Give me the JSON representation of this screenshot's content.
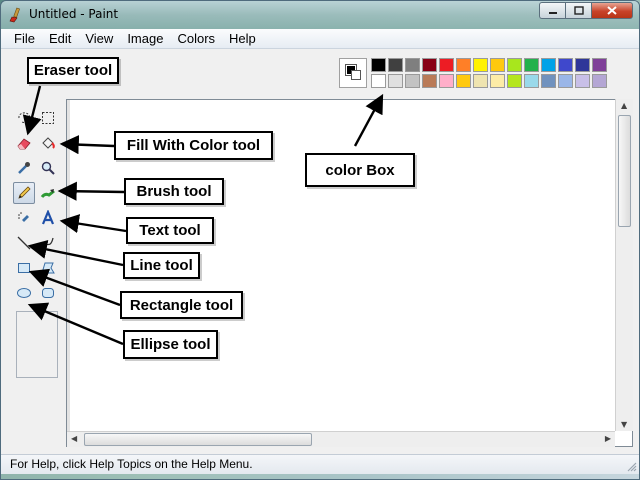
{
  "window": {
    "title": "Untitled - Paint",
    "app_icon": "paint-brush-icon",
    "controls": [
      "minimize-icon",
      "maximize-icon",
      "close-icon"
    ]
  },
  "menubar": {
    "items": [
      "File",
      "Edit",
      "View",
      "Image",
      "Colors",
      "Help"
    ]
  },
  "toolbox": {
    "tools": [
      {
        "icon": "free-form-select-icon"
      },
      {
        "icon": "rectangle-select-icon"
      },
      {
        "icon": "eraser-icon"
      },
      {
        "icon": "fill-bucket-icon"
      },
      {
        "icon": "color-picker-icon"
      },
      {
        "icon": "magnifier-icon"
      },
      {
        "icon": "pencil-icon",
        "selected": true
      },
      {
        "icon": "brush-icon"
      },
      {
        "icon": "airbrush-icon"
      },
      {
        "icon": "text-icon"
      },
      {
        "icon": "line-icon"
      },
      {
        "icon": "curve-icon"
      },
      {
        "icon": "rectangle-icon"
      },
      {
        "icon": "polygon-icon"
      },
      {
        "icon": "ellipse-icon"
      },
      {
        "icon": "rounded-rectangle-icon"
      }
    ]
  },
  "palette": {
    "foreground": "#000000",
    "background": "#ffffff",
    "row1": [
      "#000000",
      "#404040",
      "#7f7f7f",
      "#880015",
      "#ed1c24",
      "#ff7f27",
      "#fff200",
      "#ffc90e",
      "#a8e61d",
      "#22b14c",
      "#00a2e8",
      "#3f48cc",
      "#2f3699",
      "#7f3f98"
    ],
    "row2": [
      "#ffffff",
      "#e0e0e0",
      "#c3c3c3",
      "#b97a57",
      "#ffaec9",
      "#ffc90e",
      "#efe4b0",
      "#fdeca6",
      "#b5e61d",
      "#99d9ea",
      "#7092be",
      "#9ab6e8",
      "#c8bfe7",
      "#b4a6d4"
    ]
  },
  "statusbar": {
    "text": "For Help, click Help Topics on the Help Menu."
  },
  "annotations": {
    "eraser": "Eraser tool",
    "fill": "Fill With Color tool",
    "color_box": "color Box",
    "brush": "Brush tool",
    "text": "Text tool",
    "line": "Line tool",
    "rectangle": "Rectangle tool",
    "ellipse": "Ellipse tool"
  }
}
